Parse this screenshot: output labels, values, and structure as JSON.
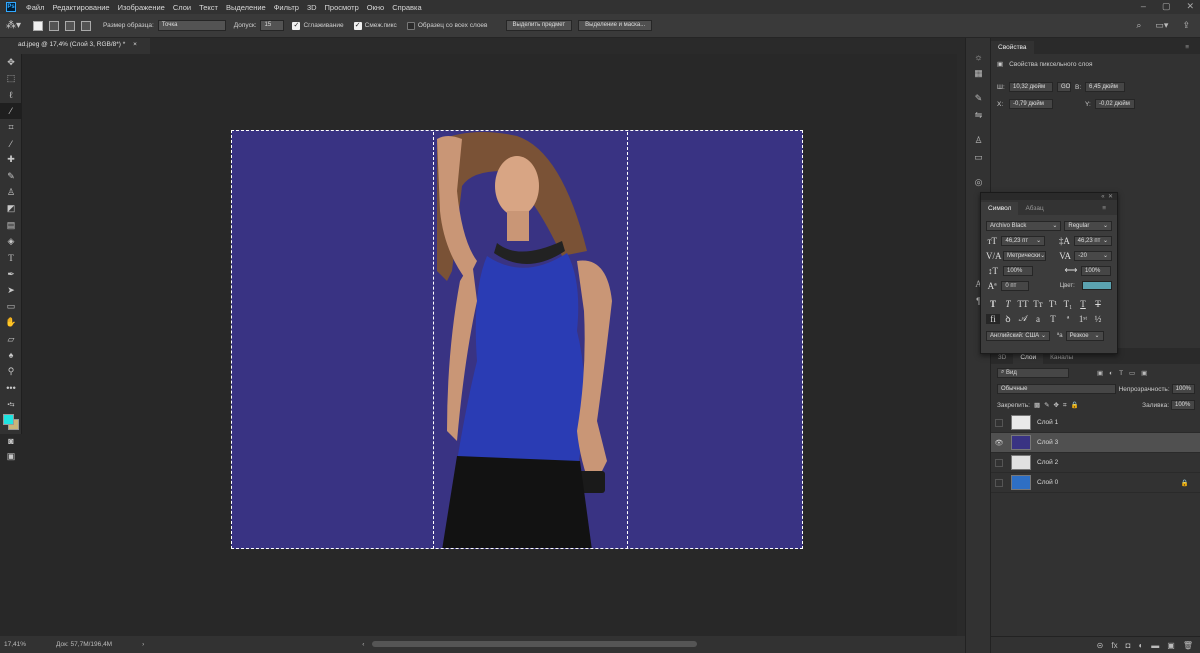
{
  "app": {
    "logo": "Ps"
  },
  "menu": [
    "Файл",
    "Редактирование",
    "Изображение",
    "Слои",
    "Текст",
    "Выделение",
    "Фильтр",
    "3D",
    "Просмотр",
    "Окно",
    "Справка"
  ],
  "options": {
    "sample_size_label": "Размер образца:",
    "sample_size_value": "Точка",
    "tolerance_label": "Допуск:",
    "tolerance_value": "15",
    "antialias_label": "Сглаживание",
    "contiguous_label": "Смеж.пикс",
    "sample_all_label": "Образец со всех слоев",
    "select_subject": "Выделить предмет",
    "select_mask": "Выделение и маска..."
  },
  "document": {
    "tab_title": "ad.jpeg @ 17,4% (Слой 3, RGB/8*) *",
    "close": "×"
  },
  "status": {
    "zoom": "17,41%",
    "doc_info": "Док: 57,7M/196,4M"
  },
  "properties": {
    "tab": "Свойства",
    "subtitle": "Свойства пиксельного слоя",
    "w_label": "Ш:",
    "w_value": "10,32 дюйм",
    "link": "GO",
    "h_label": "В:",
    "h_value": "6,45 дюйм",
    "x_label": "X:",
    "x_value": "-0,79 дюйм",
    "y_label": "Y:",
    "y_value": "-0,02 дюйм"
  },
  "character": {
    "tabs": [
      "Символ",
      "Абзац"
    ],
    "font": "Archivo Black",
    "style": "Regular",
    "size": "46,23 пт",
    "leading": "46,23 пт",
    "kerning": "Метрически",
    "tracking": "-20",
    "v_scale": "100%",
    "h_scale": "100%",
    "baseline": "0 пт",
    "color_label": "Цвет:",
    "color": "#5ba3b1",
    "language": "Английский: США",
    "aa_label": "a",
    "antialias": "Резкое"
  },
  "layers": {
    "tabs": [
      "3D",
      "Слои",
      "Каналы"
    ],
    "filter": "Вид",
    "blend": "Обычные",
    "opacity_label": "Непрозрачность:",
    "opacity": "100%",
    "lock_label": "Закрепить:",
    "fill_label": "Заливка:",
    "fill": "100%",
    "items": [
      {
        "name": "Слой 1",
        "visible": false,
        "selected": false
      },
      {
        "name": "Слой 3",
        "visible": true,
        "selected": true
      },
      {
        "name": "Слой 2",
        "visible": false,
        "selected": false
      },
      {
        "name": "Слой 0",
        "visible": false,
        "selected": false,
        "locked": true
      }
    ]
  },
  "colors": {
    "canvas": "#393383",
    "foreground": "#1ee4e1",
    "background": "#c9b57a"
  }
}
